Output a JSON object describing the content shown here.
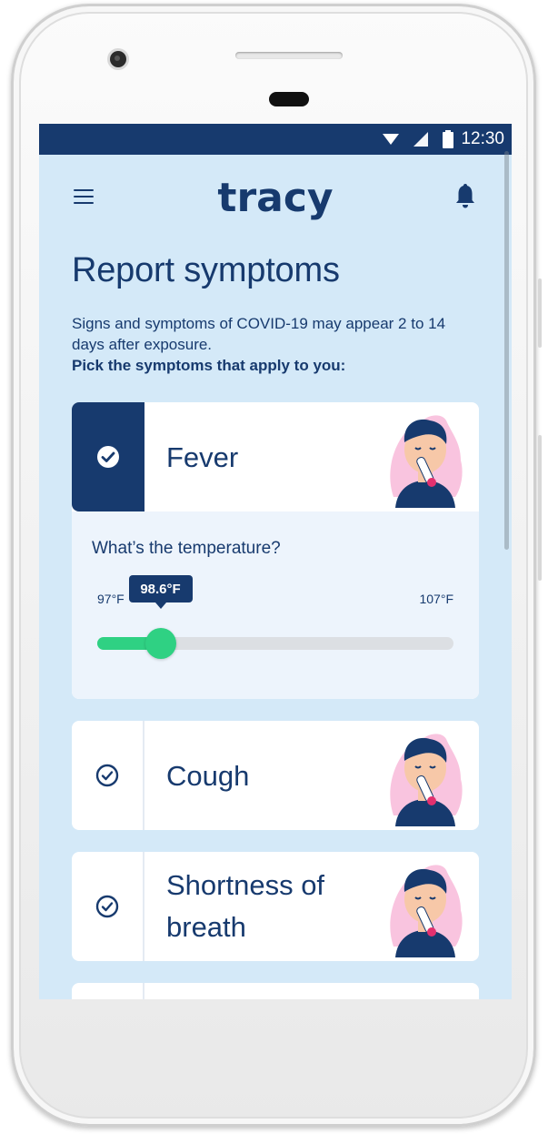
{
  "status_bar": {
    "time": "12:30"
  },
  "app": {
    "logo_text": "tracy"
  },
  "page": {
    "title": "Report symptoms",
    "description": "Signs and symptoms of COVID-19 may appear 2 to 14 days after exposure.",
    "instruction": "Pick the symptoms that apply to you:"
  },
  "symptoms": [
    {
      "label": "Fever",
      "selected": true
    },
    {
      "label": "Cough",
      "selected": false
    },
    {
      "label": "Shortness of breath",
      "selected": false
    }
  ],
  "temperature": {
    "question": "What’s the temperature?",
    "min_label": "97°F",
    "max_label": "107°F",
    "value_label": "98.6°F",
    "min": 97,
    "max": 107,
    "value": 98.6
  },
  "colors": {
    "primary": "#173a6e",
    "accent": "#2fd183",
    "background": "#d4e9f8"
  },
  "icons": [
    "menu-icon",
    "bell-icon",
    "check-circle-icon",
    "wifi-icon",
    "signal-icon",
    "battery-icon"
  ]
}
